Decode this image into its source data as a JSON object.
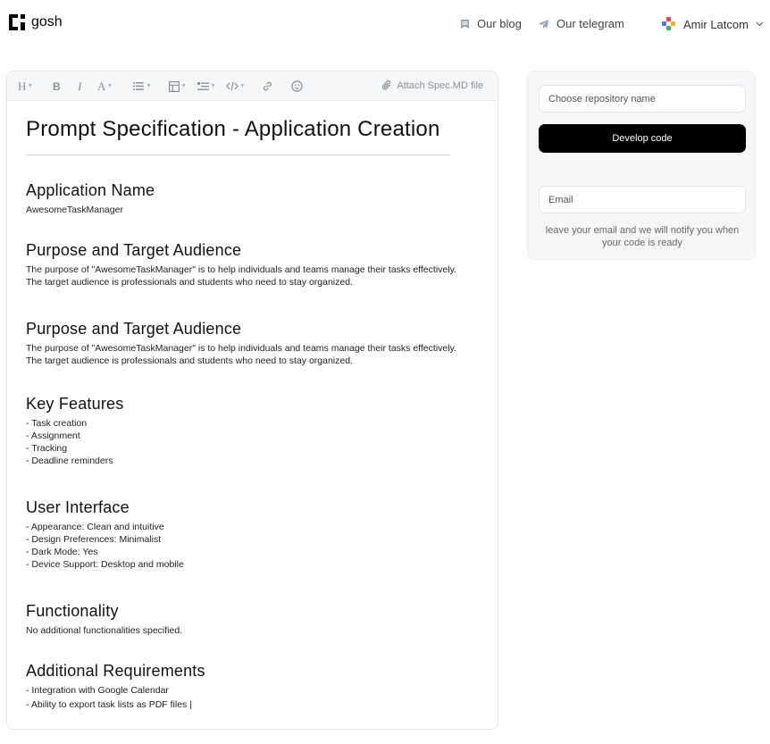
{
  "header": {
    "logo_text": "gosh",
    "nav": [
      {
        "label": "Our blog",
        "icon": "book-icon"
      },
      {
        "label": "Our telegram",
        "icon": "telegram-icon"
      }
    ],
    "user": {
      "name": "Amir Latcom",
      "icon": "user-avatar-icon"
    }
  },
  "toolbar": {
    "heading": "H",
    "bold": "B",
    "italic": "I",
    "font_color": "A",
    "attach_label": "Attach Spec.MD file"
  },
  "document": {
    "title": "Prompt Specification - Application Creation",
    "sections": [
      {
        "heading": "Application Name",
        "lines": [
          "AwesomeTaskManager"
        ]
      },
      {
        "heading": "Purpose and Target Audience",
        "lines": [
          "The purpose of \"AwesomeTaskManager\" is to help individuals and teams manage their tasks effectively.",
          "The target audience is professionals and students who need to stay organized."
        ]
      },
      {
        "heading": "Purpose and Target Audience",
        "lines": [
          "The purpose of \"AwesomeTaskManager\" is to help individuals and teams manage their tasks effectively.",
          "The target audience is professionals and students who need to stay organized."
        ]
      },
      {
        "heading": "Key Features",
        "lines": [
          "- Task creation",
          "- Assignment",
          "- Tracking",
          "- Deadline reminders"
        ]
      },
      {
        "heading": "User Interface",
        "lines": [
          "- Appearance: Clean and intuitive",
          "- Design Preferences: Minimalist",
          "- Dark Mode: Yes",
          "- Device Support: Desktop and mobile"
        ]
      },
      {
        "heading": "Functionality",
        "lines": [
          "No additional functionalities specified."
        ]
      },
      {
        "heading": "Additional Requirements",
        "lines": [
          "- Integration with Google Calendar",
          "- Ability to export task lists as PDF files |"
        ]
      }
    ]
  },
  "panel": {
    "repo_placeholder": "Choose repository name",
    "develop_button": "Develop code",
    "email_placeholder": "Email",
    "note": "leave your email and we will notify you when your code is ready"
  },
  "colors": {
    "accent": "#000000",
    "panel_bg": "#f6f7f9",
    "muted": "#8a8f98"
  }
}
